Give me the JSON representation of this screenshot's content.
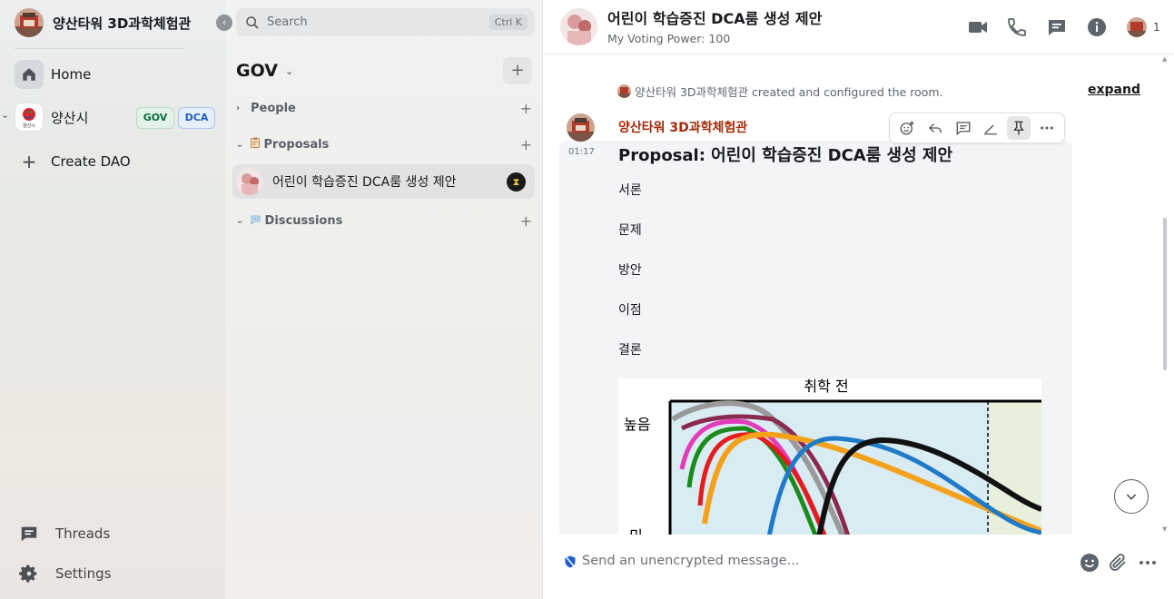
{
  "sidebar": {
    "org_name": "양산타워 3D과학체험관",
    "collapse_label": "‹",
    "items": {
      "home": "Home",
      "space": "양산시",
      "create": "Create DAO",
      "threads": "Threads",
      "settings": "Settings"
    },
    "space_logo_text": "양산시",
    "pills": [
      "GOV",
      "DCA"
    ]
  },
  "roomlist": {
    "search_placeholder": "Search",
    "search_shortcut": "Ctrl K",
    "space_title": "GOV",
    "sections": {
      "people": "People",
      "proposals": "Proposals",
      "discussions": "Discussions"
    },
    "rooms": [
      {
        "name": "어린이 학습증진 DCA룸 생성 제안"
      }
    ]
  },
  "room": {
    "title": "어린이 학습증진 DCA룸 생성 제안",
    "subtitle": "My Voting Power: 100",
    "member_count": "1"
  },
  "timeline": {
    "created_event": "양산타워 3D과학체험관 created and configured the room.",
    "expand": "expand",
    "message": {
      "sender": "양산타워 3D과학체험관",
      "time": "01:17",
      "title": "Proposal: 어린이 학습증진 DCA룸 생성 제안",
      "lines": [
        "서론",
        "문제",
        "방안",
        "이점",
        "결론"
      ],
      "figure": {
        "title": "취학 전",
        "label_high": "높음",
        "label_vertical": "민감"
      }
    }
  },
  "composer": {
    "placeholder": "Send an unencrypted message..."
  },
  "colors": {
    "sender": "#a52a08",
    "gov_pill": "#0d6b3a",
    "dca_pill": "#1d5fc4"
  }
}
